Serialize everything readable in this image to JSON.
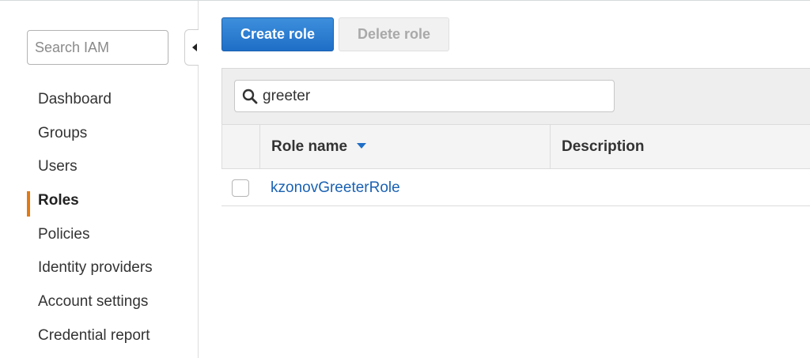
{
  "sidebar": {
    "search": {
      "placeholder": "Search IAM",
      "value": ""
    },
    "collapse_icon": "triangle-left-icon",
    "items": [
      {
        "label": "Dashboard",
        "active": false
      },
      {
        "label": "Groups",
        "active": false
      },
      {
        "label": "Users",
        "active": false
      },
      {
        "label": "Roles",
        "active": true
      },
      {
        "label": "Policies",
        "active": false
      },
      {
        "label": "Identity providers",
        "active": false
      },
      {
        "label": "Account settings",
        "active": false
      },
      {
        "label": "Credential report",
        "active": false
      }
    ],
    "active_accent": "#e47911"
  },
  "toolbar": {
    "create_label": "Create role",
    "delete_label": "Delete role",
    "primary_color": "#1f6ec7"
  },
  "filter": {
    "icon": "search-icon",
    "value": "greeter"
  },
  "table": {
    "columns": [
      "Role name",
      "Description"
    ],
    "sort_column": "Role name",
    "sort_direction": "descending",
    "rows": [
      {
        "role_name": "kzonovGreeterRole",
        "description": "",
        "checked": false
      }
    ],
    "link_color": "#1a62b3"
  }
}
